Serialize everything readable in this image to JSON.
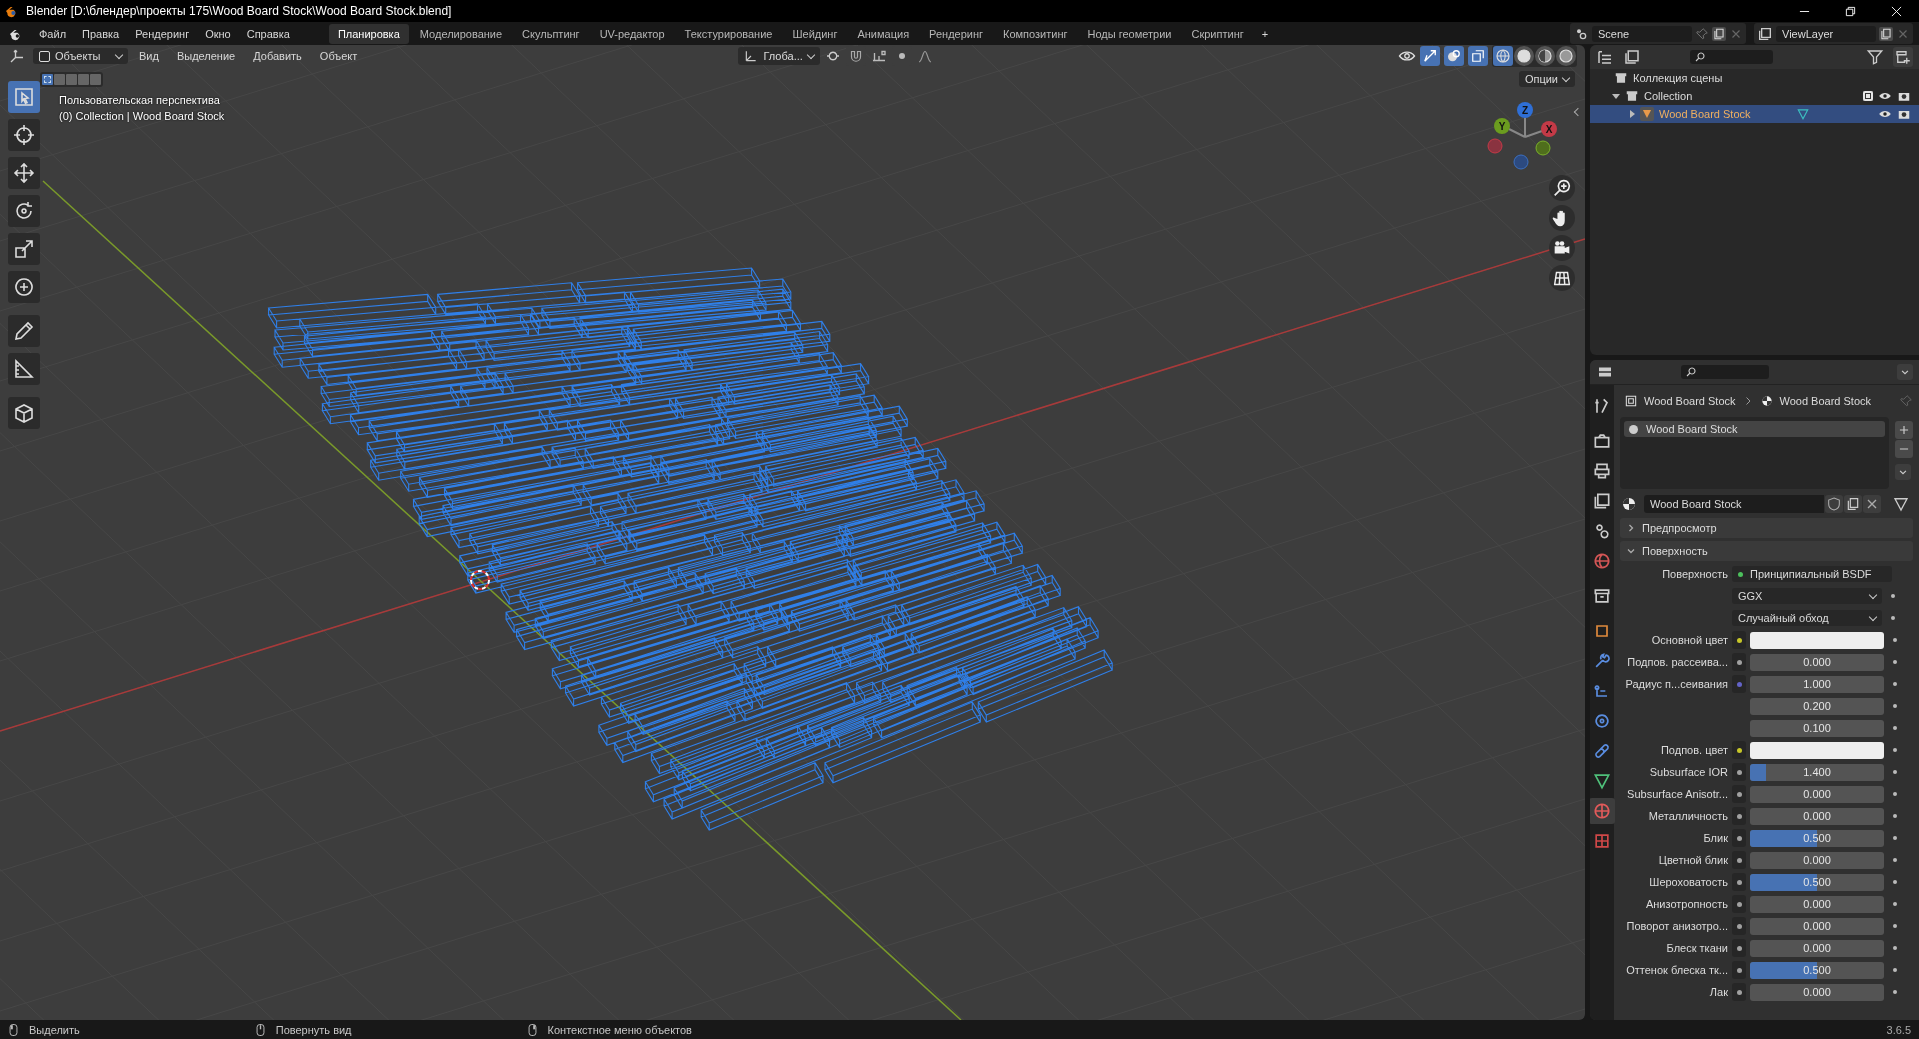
{
  "window": {
    "title": "Blender [D:\\блендер\\проекты 175\\Wood Board Stock\\Wood Board Stock.blend]"
  },
  "menus": [
    "Файл",
    "Правка",
    "Рендеринг",
    "Окно",
    "Справка"
  ],
  "workspaces": [
    {
      "label": "Планировка",
      "selected": true
    },
    {
      "label": "Моделирование",
      "selected": false
    },
    {
      "label": "Скульптинг",
      "selected": false
    },
    {
      "label": "UV-редактор",
      "selected": false
    },
    {
      "label": "Текстурирование",
      "selected": false
    },
    {
      "label": "Шейдинг",
      "selected": false
    },
    {
      "label": "Анимация",
      "selected": false
    },
    {
      "label": "Рендеринг",
      "selected": false
    },
    {
      "label": "Композитинг",
      "selected": false
    },
    {
      "label": "Ноды геометрии",
      "selected": false
    },
    {
      "label": "Скриптинг",
      "selected": false
    }
  ],
  "add_workspace": "+",
  "scene": "Scene",
  "view_layer": "ViewLayer",
  "viewport": {
    "mode": "Объекты",
    "menus": [
      "Вид",
      "Выделение",
      "Добавить",
      "Объект"
    ],
    "orientation": "Глоба...",
    "options": "Опции",
    "info": [
      "Пользовательская перспектива",
      "(0) Collection | Wood Board Stock"
    ],
    "gizmo": [
      "Z",
      "Y",
      "X"
    ],
    "shading": [
      {
        "selected": true
      },
      {
        "selected": false
      },
      {
        "selected": false
      },
      {
        "selected": false
      }
    ],
    "tools": [
      {
        "selected": true
      },
      {
        "selected": false
      },
      {
        "selected": false
      },
      {
        "selected": false
      },
      {
        "selected": false
      },
      {
        "selected": false
      },
      {
        "selected": false
      },
      {
        "selected": false
      },
      {
        "selected": false
      }
    ]
  },
  "outliner": {
    "root": "Коллекция сцены",
    "items": [
      {
        "label": "Collection",
        "kind": "collection",
        "expanded": true,
        "checked": true,
        "selected": false,
        "children": [
          {
            "label": "Wood Board Stock",
            "kind": "object",
            "expanded": false,
            "selected": true
          }
        ]
      }
    ]
  },
  "properties": {
    "tabs": [
      {
        "selected": false
      },
      {
        "selected": false
      },
      {
        "selected": false
      },
      {
        "selected": false
      },
      {
        "selected": false
      },
      {
        "selected": false
      },
      {
        "selected": false
      },
      {
        "selected": false
      },
      {
        "selected": false
      },
      {
        "selected": false
      },
      {
        "selected": false
      },
      {
        "selected": false
      },
      {
        "selected": false
      },
      {
        "selected": true
      },
      {
        "selected": false
      }
    ],
    "breadcrumb": [
      "Wood Board Stock",
      "Wood Board Stock"
    ],
    "slots": [
      {
        "name": "Wood Board Stock",
        "selected": true
      }
    ],
    "material": "Wood Board Stock",
    "panels": [
      {
        "label": "Предпросмотр",
        "expanded": false
      },
      {
        "label": "Поверхность",
        "expanded": true
      }
    ],
    "surface": {
      "label": "Поверхность",
      "value": "Принципиальный BSDF"
    },
    "dropdowns": [
      "GGX",
      "Случайный обход"
    ],
    "rows": [
      {
        "label": "Основной цвет",
        "kind": "color",
        "color": "#c7c729"
      },
      {
        "label": "Подпов. рассеива...",
        "kind": "value",
        "color": "#a1a1a1",
        "value": "0.000"
      },
      {
        "label": "Радиус п...сеивания",
        "kind": "vector",
        "color": "#6363c7",
        "values": [
          "1.000",
          "0.200",
          "0.100"
        ]
      },
      {
        "label": "Подпов. цвет",
        "kind": "color",
        "color": "#c7c729"
      },
      {
        "label": "Subsurface IOR",
        "kind": "value",
        "color": "#a1a1a1",
        "value": "1.400",
        "level": 0.12
      },
      {
        "label": "Subsurface Anisotr...",
        "kind": "value",
        "color": "#a1a1a1",
        "value": "0.000"
      },
      {
        "label": "Металличность",
        "kind": "value",
        "color": "#a1a1a1",
        "value": "0.000"
      },
      {
        "label": "Блик",
        "kind": "value",
        "color": "#a1a1a1",
        "value": "0.500",
        "level": 0.5
      },
      {
        "label": "Цветной блик",
        "kind": "value",
        "color": "#a1a1a1",
        "value": "0.000"
      },
      {
        "label": "Шероховатость",
        "kind": "value",
        "color": "#a1a1a1",
        "value": "0.500",
        "level": 0.5
      },
      {
        "label": "Анизотропность",
        "kind": "value",
        "color": "#a1a1a1",
        "value": "0.000"
      },
      {
        "label": "Поворот анизотро...",
        "kind": "value",
        "color": "#a1a1a1",
        "value": "0.000"
      },
      {
        "label": "Блеск ткани",
        "kind": "value",
        "color": "#a1a1a1",
        "value": "0.000"
      },
      {
        "label": "Оттенок блеска тк...",
        "kind": "value",
        "color": "#a1a1a1",
        "value": "0.500",
        "level": 0.5
      },
      {
        "label": "Лак",
        "kind": "value",
        "color": "#a1a1a1",
        "value": "0.000"
      }
    ]
  },
  "status": [
    {
      "label": "Выделить"
    },
    {
      "label": "Повернуть вид"
    },
    {
      "label": "Контекстное меню объектов"
    }
  ],
  "version": "3.6.5"
}
